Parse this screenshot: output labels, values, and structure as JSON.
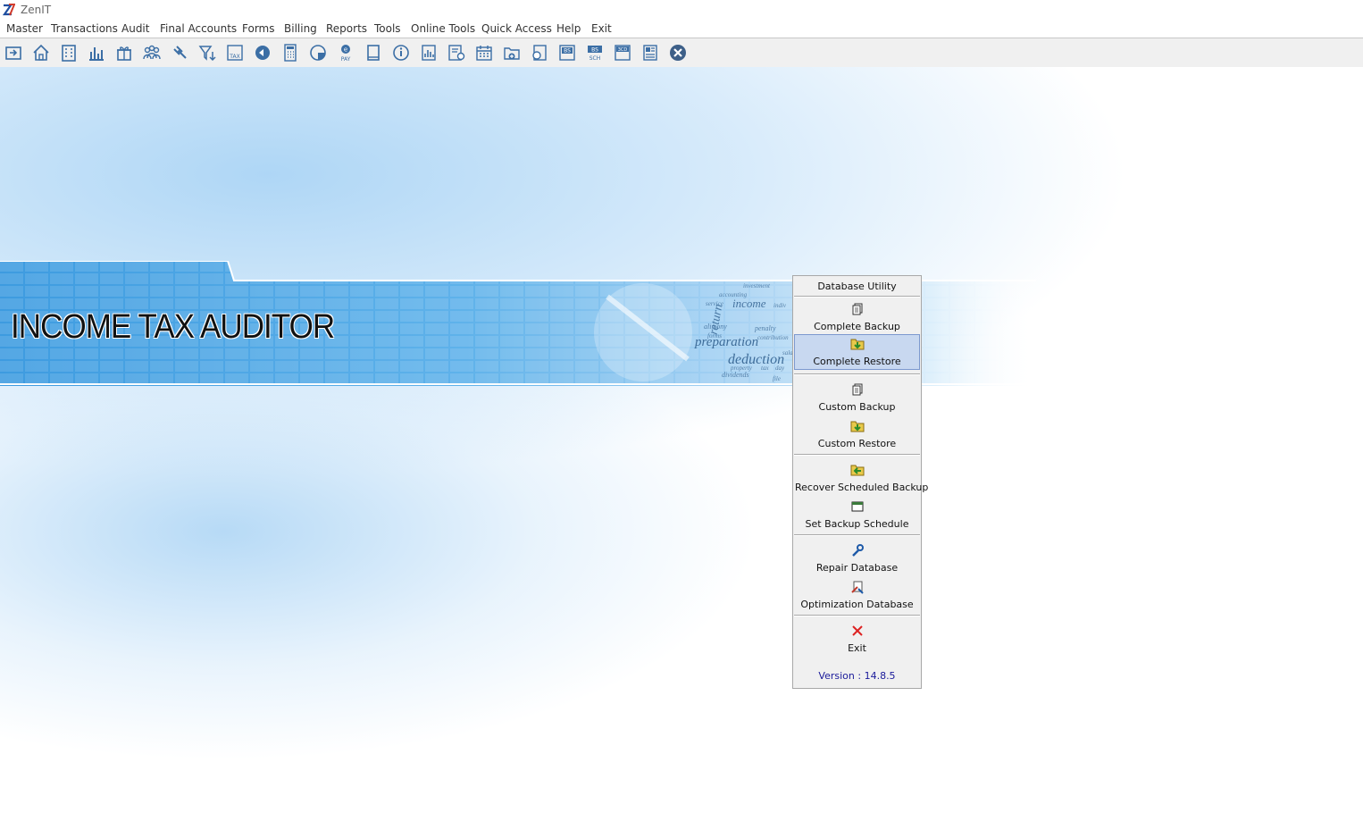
{
  "app": {
    "title": "ZenIT"
  },
  "menu": [
    "Master",
    "Transactions",
    "Audit",
    "Final Accounts",
    "Forms",
    "Billing",
    "Reports",
    "Tools",
    "Online Tools",
    "Quick Access",
    "Help",
    "Exit"
  ],
  "toolbar_icons": [
    "return-icon",
    "home-icon",
    "building-icon",
    "bar-chart-icon",
    "gift-icon",
    "group-icon",
    "gavel-icon",
    "filter-icon",
    "tax-icon",
    "target-icon",
    "calculator-icon",
    "pie-chart-icon",
    "epay-icon",
    "book-icon",
    "info-icon",
    "report-icon",
    "certificate-icon",
    "calendar-icon",
    "folder-add-icon",
    "search-doc-icon",
    "bs-icon",
    "bs-sch-icon",
    "3cd-icon",
    "form-icon",
    "close-circle-icon"
  ],
  "toolbar_labels": {
    "tax": "TAX",
    "pay": "PAY",
    "bs": "BS",
    "sch": "SCH",
    "cd": "3CD"
  },
  "banner": {
    "title": "INCOME TAX AUDITOR",
    "words": [
      "preparation",
      "deduction",
      "return",
      "income",
      "penalty",
      "investment",
      "accounting",
      "service",
      "alimony",
      "dividends",
      "property",
      "tax",
      "day",
      "file",
      "forms",
      "contribution",
      "sala",
      "indiv"
    ]
  },
  "db_utility": {
    "title": "Database Utility",
    "items": [
      {
        "label": "Complete Backup",
        "icon": "copy-icon"
      },
      {
        "label": "Complete Restore",
        "icon": "restore-icon",
        "active": true
      },
      {
        "label": "Custom Backup",
        "icon": "copy-icon"
      },
      {
        "label": "Custom Restore",
        "icon": "restore-icon"
      },
      {
        "label": "Recover Scheduled Backup",
        "icon": "recover-icon"
      },
      {
        "label": "Set Backup Schedule",
        "icon": "window-icon"
      },
      {
        "label": "Repair Database",
        "icon": "wrench-icon"
      },
      {
        "label": "Optimization Database",
        "icon": "optimize-icon"
      },
      {
        "label": "Exit",
        "icon": "close-x-icon"
      }
    ],
    "version": "Version : 14.8.5"
  },
  "colors": {
    "accent": "#c8d8f0",
    "version_text": "#1a1a9a",
    "banner_blue": "#4aa3df"
  }
}
